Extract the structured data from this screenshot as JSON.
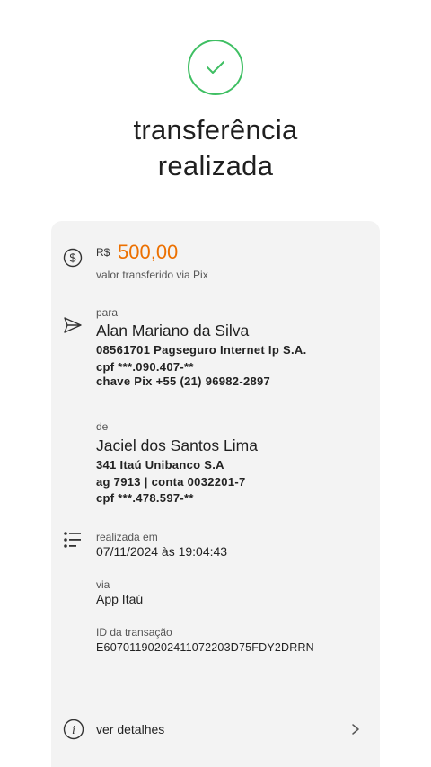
{
  "header": {
    "title_line1": "transferência",
    "title_line2": "realizada"
  },
  "amount": {
    "currency": "R$",
    "value": "500,00",
    "description": "valor transferido via Pix"
  },
  "recipient": {
    "label": "para",
    "name": "Alan Mariano da Silva",
    "bank": "08561701 Pagseguro Internet Ip S.A.",
    "cpf": "cpf ***.090.407-**",
    "pix_key": "chave Pix +55 (21) 96982-2897"
  },
  "sender": {
    "label": "de",
    "name": "Jaciel dos Santos Lima",
    "bank": "341 Itaú Unibanco S.A",
    "account": "ag 7913 | conta 0032201-7",
    "cpf": "cpf ***.478.597-**"
  },
  "details": {
    "date_label": "realizada em",
    "date_value": "07/11/2024 às 19:04:43",
    "via_label": "via",
    "via_value": "App Itaú",
    "id_label": "ID da transação",
    "id_value": "E60701190202411072203D75FDY2DRRN"
  },
  "footer": {
    "details_link": "ver detalhes"
  },
  "colors": {
    "accent": "#ec7000",
    "success": "#3fbf63",
    "card_bg": "#f3f3f3"
  },
  "icons": [
    "check-icon",
    "dollar-circle-icon",
    "send-icon",
    "list-icon",
    "info-icon",
    "chevron-right-icon"
  ]
}
